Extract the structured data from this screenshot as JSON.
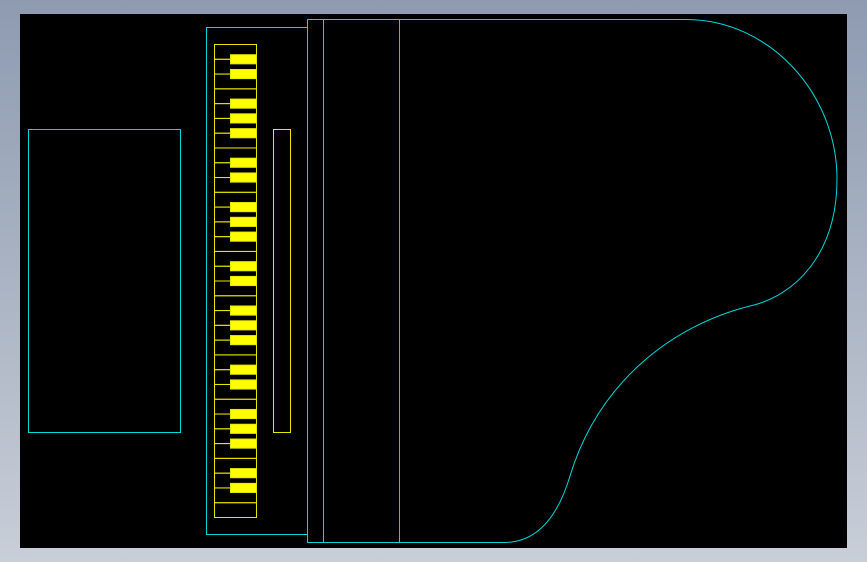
{
  "drawing": {
    "subject": "grand-piano-top-view",
    "background_color": "#000000",
    "line_color": "#00d8d8",
    "key_line_color": "#e6e600",
    "black_key_fill": "#ffff00",
    "white_key_count": 32,
    "black_key_count": 22
  }
}
